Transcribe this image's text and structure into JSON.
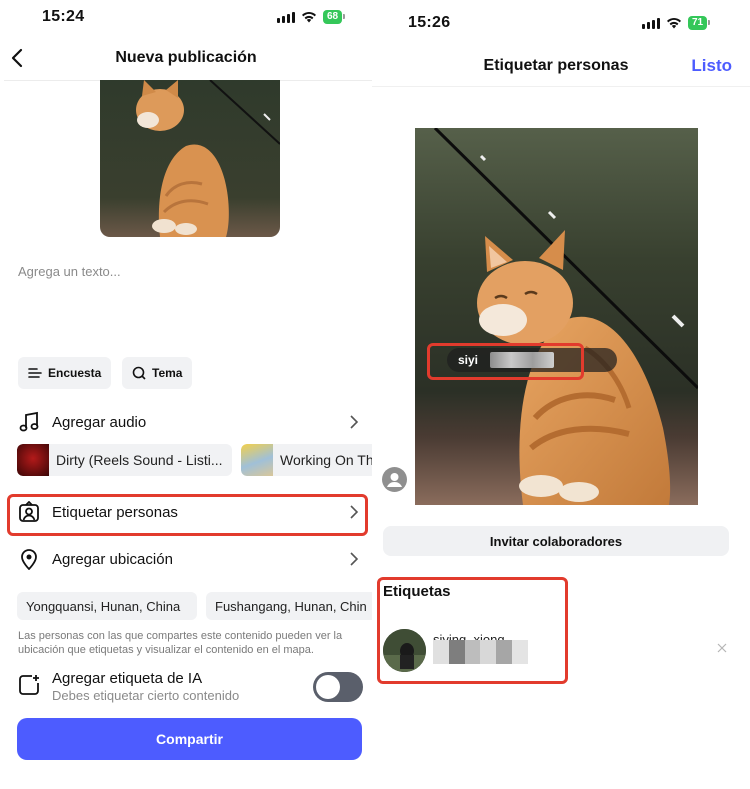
{
  "left": {
    "status": {
      "time": "15:24",
      "battery": "68"
    },
    "title": "Nueva publicación",
    "caption_placeholder": "Agrega un texto...",
    "chips": {
      "poll": "Encuesta",
      "topic": "Tema"
    },
    "add_audio": "Agregar audio",
    "music": [
      "Dirty (Reels Sound - Listi...",
      "Working On Th"
    ],
    "tag_people": "Etiquetar personas",
    "add_location": "Agregar ubicación",
    "locations": [
      "Yongquansi, Hunan, China",
      "Fushangang, Hunan, Chin"
    ],
    "disclaimer": "Las personas con las que compartes este contenido pueden ver la ubicación que etiquetas y visualizar el contenido en el mapa.",
    "ai_label": {
      "title": "Agregar etiqueta de IA",
      "subtitle": "Debes etiquetar cierto contenido",
      "enabled": false
    },
    "share": "Compartir"
  },
  "right": {
    "status": {
      "time": "15:26",
      "battery": "71"
    },
    "title": "Etiquetar personas",
    "done": "Listo",
    "photo_tag": "siyi",
    "invite": "Invitar colaboradores",
    "tags_heading": "Etiquetas",
    "tag_user": "siying_xiong"
  },
  "colors": {
    "accent": "#4d5cff",
    "highlight": "#e23b2d",
    "chip_bg": "#f1f2f4"
  }
}
